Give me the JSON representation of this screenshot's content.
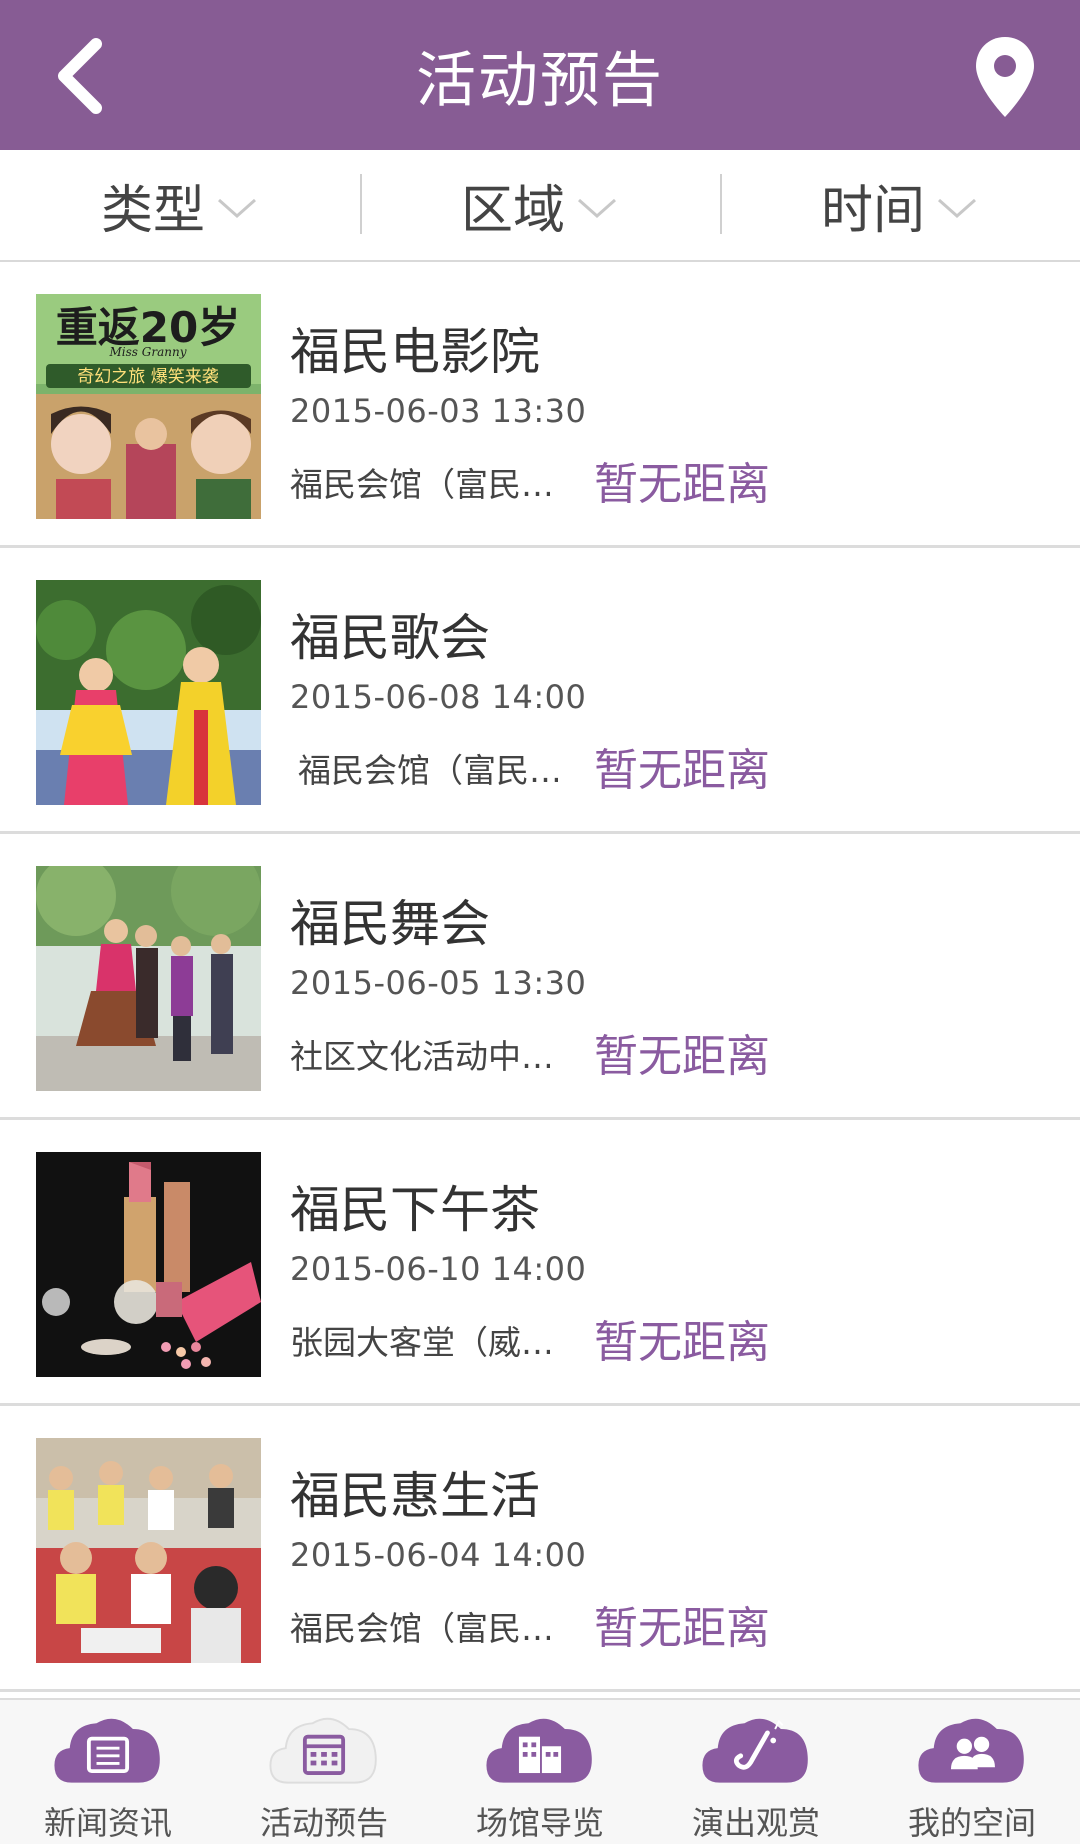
{
  "header": {
    "title": "活动预告"
  },
  "filters": [
    {
      "label": "类型"
    },
    {
      "label": "区域"
    },
    {
      "label": "时间"
    }
  ],
  "events": [
    {
      "name": "福民电影院",
      "datetime": "2015-06-03 13:30",
      "venue": "福民会馆（富民…",
      "distance": "暂无距离"
    },
    {
      "name": "福民歌会",
      "datetime": "2015-06-08 14:00",
      "venue": "福民会馆（富民…",
      "distance": "暂无距离"
    },
    {
      "name": "福民舞会",
      "datetime": "2015-06-05 13:30",
      "venue": "社区文化活动中…",
      "distance": "暂无距离"
    },
    {
      "name": "福民下午茶",
      "datetime": "2015-06-10 14:00",
      "venue": "张园大客堂（威…",
      "distance": "暂无距离"
    },
    {
      "name": "福民惠生活",
      "datetime": "2015-06-04 14:00",
      "venue": "福民会馆（富民…",
      "distance": "暂无距离"
    }
  ],
  "poster": {
    "headline": "重返20岁",
    "script": "Miss Granny",
    "tagline": "奇幻之旅 爆笑来袭"
  },
  "tabs": [
    {
      "label": "新闻资讯",
      "icon": "newspaper-icon"
    },
    {
      "label": "活动预告",
      "icon": "calendar-icon"
    },
    {
      "label": "场馆导览",
      "icon": "buildings-icon"
    },
    {
      "label": "演出观赏",
      "icon": "saxophone-icon"
    },
    {
      "label": "我的空间",
      "icon": "people-icon"
    }
  ],
  "colors": {
    "header": "#875c94",
    "accent": "#8a5ba0",
    "tab_icon": "#8a5ba0",
    "tab_icon_active": "#f0f0f0"
  }
}
